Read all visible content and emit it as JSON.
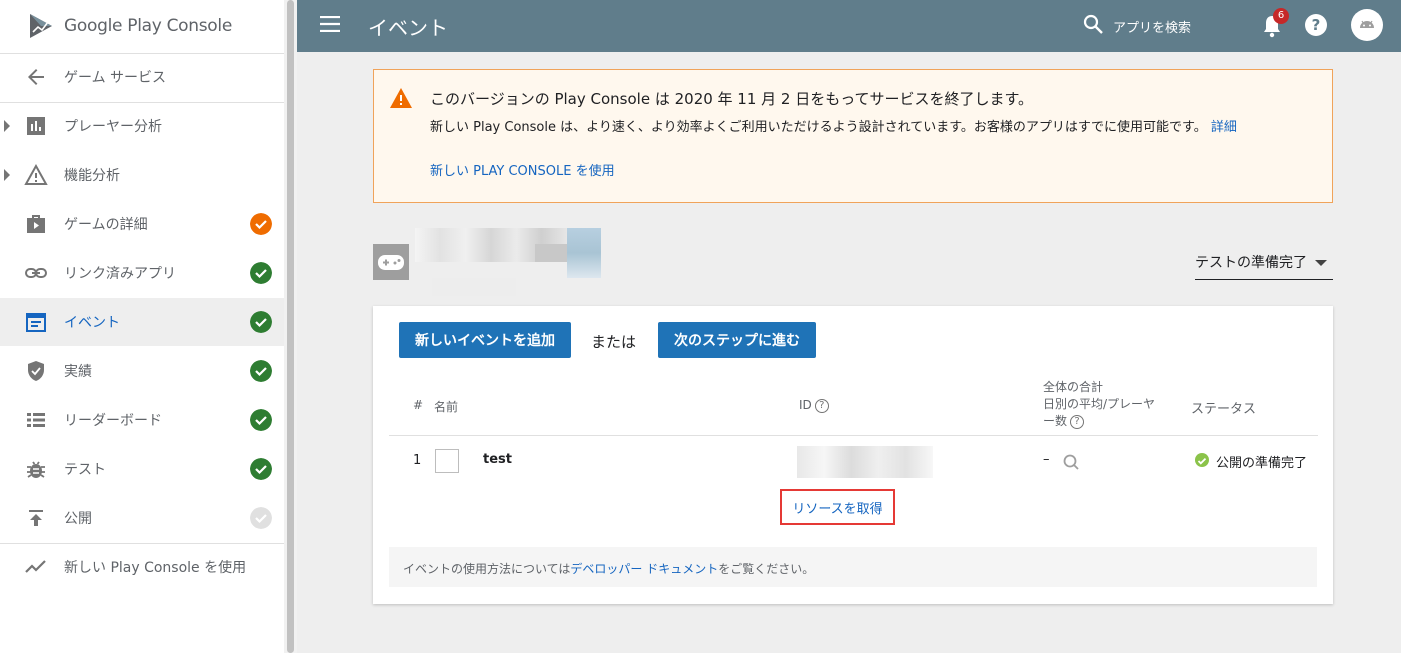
{
  "sidebar": {
    "logo_text": "Google Play Console",
    "back_label": "ゲーム サービス",
    "items": [
      {
        "label": "プレーヤー分析",
        "status": "none"
      },
      {
        "label": "機能分析",
        "status": "none"
      },
      {
        "label": "ゲームの詳細",
        "status": "warning"
      },
      {
        "label": "リンク済みアプリ",
        "status": "done"
      },
      {
        "label": "イベント",
        "status": "done"
      },
      {
        "label": "実績",
        "status": "done"
      },
      {
        "label": "リーダーボード",
        "status": "done"
      },
      {
        "label": "テスト",
        "status": "done"
      },
      {
        "label": "公開",
        "status": "pending"
      }
    ],
    "new_console_label": "新しい Play Console を使用"
  },
  "header": {
    "title": "イベント",
    "search_label": "アプリを検索",
    "notification_count": "6",
    "help_label": "?"
  },
  "banner": {
    "title": "このバージョンの Play Console は 2020 年 11 月 2 日をもってサービスを終了します。",
    "body": "新しい Play Console は、より速く、より効率よくご利用いただけるよう設計されています。お客様のアプリはすでに使用可能です。",
    "details_link": "詳細",
    "cta": "新しい PLAY CONSOLE を使用"
  },
  "app": {
    "status_dropdown": "テストの準備完了"
  },
  "card": {
    "add_button": "新しいイベントを追加",
    "or_text": "または",
    "next_button": "次のステップに進む",
    "columns": {
      "num": "#",
      "name": "名前",
      "id": "ID",
      "total_line1": "全体の合計",
      "total_line2": "日別の平均/プレーヤ",
      "total_line3": "ー数",
      "status": "ステータス"
    },
    "rows": [
      {
        "num": "1",
        "name": "test",
        "total": "–",
        "status": "公開の準備完了"
      }
    ],
    "resource_link": "リソースを取得",
    "footer_prefix": "イベントの使用方法については",
    "footer_link": "デベロッパー ドキュメント",
    "footer_suffix": "をご覧ください。"
  },
  "colors": {
    "topbar": "#607d8b",
    "accent_blue": "#1565c0",
    "done_green": "#2e7d32",
    "warn_orange": "#ef6c00",
    "banner_bg": "#fff8ee",
    "banner_border": "#f0a35a"
  }
}
